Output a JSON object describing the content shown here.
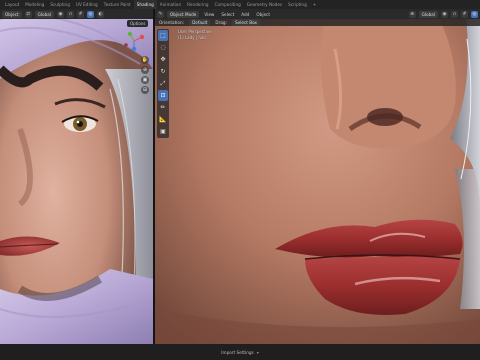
{
  "workspaces": [
    "Layout",
    "Modeling",
    "Sculpting",
    "UV Editing",
    "Texture Paint",
    "Shading",
    "Animation",
    "Rendering",
    "Compositing",
    "Geometry Nodes",
    "Scripting",
    "+"
  ],
  "active_workspace": "Shading",
  "left_viewport": {
    "mode_label": "Object",
    "transform_dd": "Global",
    "options_label": "Options"
  },
  "right_viewport": {
    "orientation_label": "Orientation:",
    "orientation_value": "Default",
    "drag_label": "Drag:",
    "drag_value": "Select Box",
    "mode_label": "Object Mode",
    "menu": [
      "View",
      "Select",
      "Add",
      "Object"
    ],
    "transform_dd": "Global",
    "info_line1": "User Perspective",
    "info_line2": "(1) Lady | hair"
  },
  "tools": [
    "select-box",
    "cursor",
    "move",
    "rotate",
    "scale",
    "transform",
    "annotate",
    "measure",
    "add-cube"
  ],
  "status": {
    "text": "Import Settings"
  },
  "colors": {
    "accent": "#4772b3",
    "header": "#2a2a2a",
    "hood": "#b8a8d6"
  },
  "icons": [
    "cursor-icon",
    "globe-icon",
    "magnet-icon",
    "grid-icon",
    "eye-icon",
    "hand-icon",
    "zoom-icon",
    "camera-icon"
  ]
}
